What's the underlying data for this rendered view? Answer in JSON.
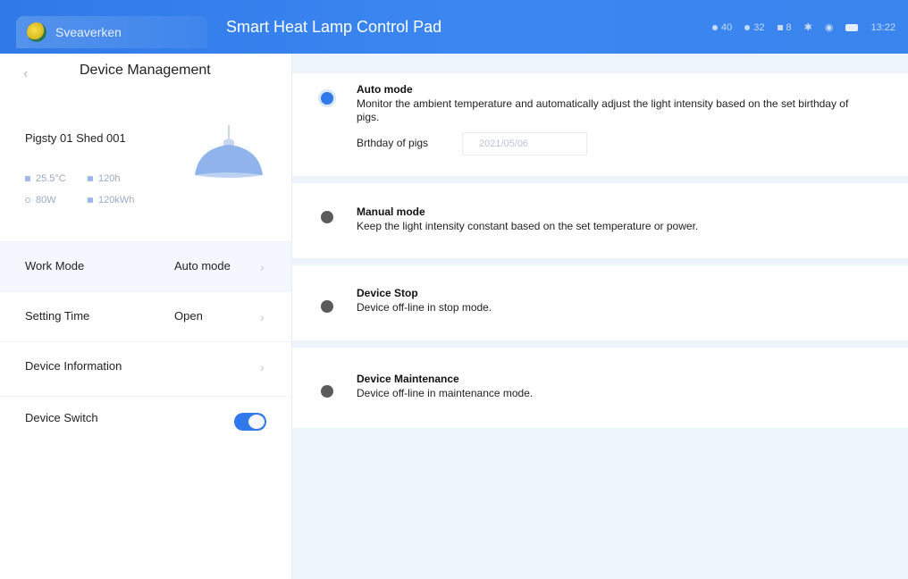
{
  "topbar": {
    "brand_name": "Sveaverken",
    "title": "Smart Heat Lamp Control Pad",
    "status": [
      "40",
      "32",
      "8"
    ],
    "clock": "13:22",
    "accent": "#2f7ae8"
  },
  "left": {
    "back_icon": "back-chevron-icon",
    "title": "Device Management",
    "device": {
      "name": "Pigsty 01 Shed 001",
      "temperature": "25.5°C",
      "hours": "120h",
      "power": "80W",
      "energy": "120kWh"
    },
    "menu": {
      "work_mode_label": "Work Mode",
      "work_mode_value": "Auto mode",
      "setting_time_label": "Setting Time",
      "setting_time_value": "Open",
      "device_info_label": "Device Information",
      "device_switch_label": "Device Switch",
      "device_switch_on": true
    }
  },
  "modes": [
    {
      "title": "Auto mode",
      "desc": "Monitor the ambient temperature and automatically adjust the light intensity based on the set birthday of pigs.",
      "selected": true
    },
    {
      "title": "Manual mode",
      "desc": "Keep the light intensity constant based on the set temperature or power.",
      "selected": false
    },
    {
      "title": "Device Stop",
      "desc": "Device off-line in stop mode.",
      "selected": false
    },
    {
      "title": "Device Maintenance",
      "desc": "Device off-line in maintenance mode.",
      "selected": false
    }
  ],
  "birthday": {
    "label": "Brthday of pigs",
    "value": "2021/05/06"
  }
}
